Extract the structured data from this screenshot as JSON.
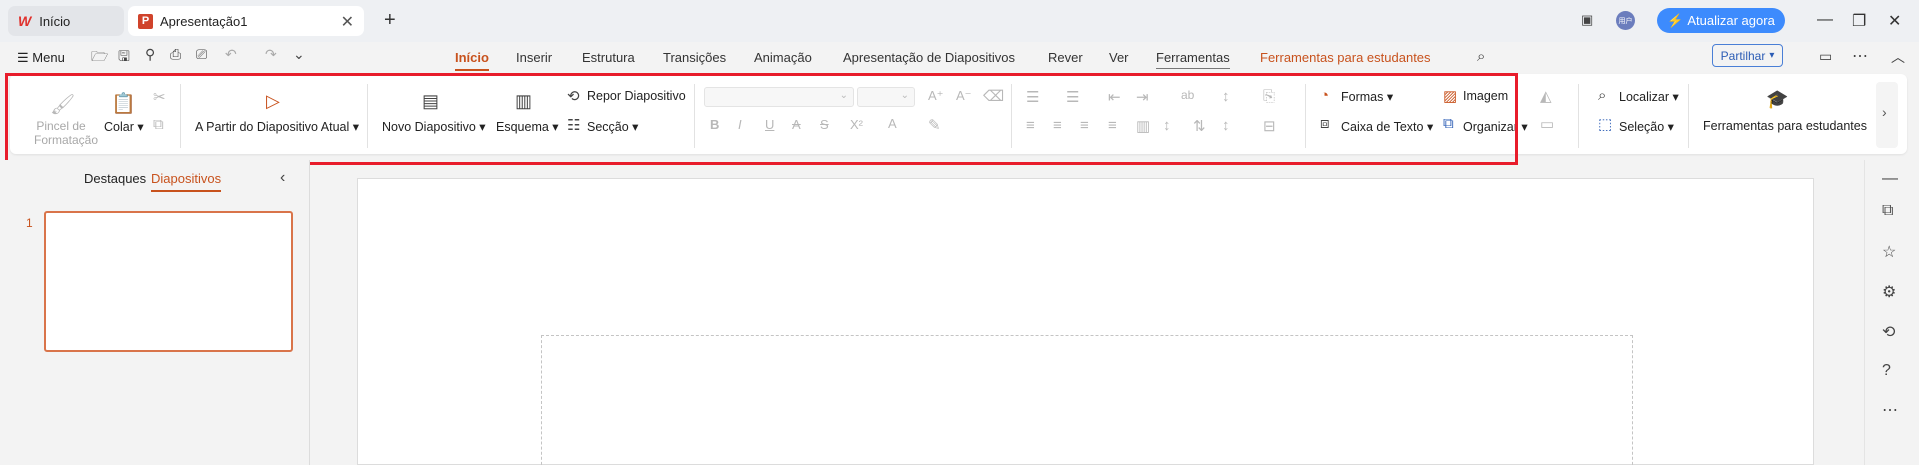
{
  "titlebar": {
    "home_tab": "Início",
    "doc_tab": "Apresentação1",
    "upgrade_label": "Atualizar agora",
    "avatar_text": "用户"
  },
  "menu": {
    "menu_label": "Menu",
    "tabs": [
      "Início",
      "Inserir",
      "Estrutura",
      "Transições",
      "Animação",
      "Apresentação de Diapositivos",
      "Rever",
      "Ver",
      "Ferramentas",
      "Ferramentas para estudantes"
    ],
    "share_label": "Partilhar"
  },
  "ribbon": {
    "format_painter": "Pincel de Formatação",
    "paste": "Colar",
    "from_current": "A Partir do Diapositivo Atual",
    "new_slide": "Novo Diapositivo",
    "layout": "Esquema",
    "reset_slide": "Repor Diapositivo",
    "section": "Secção",
    "shapes": "Formas",
    "text_box": "Caixa de Texto",
    "image": "Imagem",
    "arrange": "Organizar",
    "find": "Localizar",
    "select": "Seleção",
    "student_tools": "Ferramentas para estudantes"
  },
  "panel": {
    "outline_tab": "Destaques",
    "slides_tab": "Diapositivos",
    "slide_number": "1"
  },
  "colors": {
    "accent": "#c8521d",
    "highlight": "#e81c2b",
    "upgrade": "#3d8bfd"
  }
}
